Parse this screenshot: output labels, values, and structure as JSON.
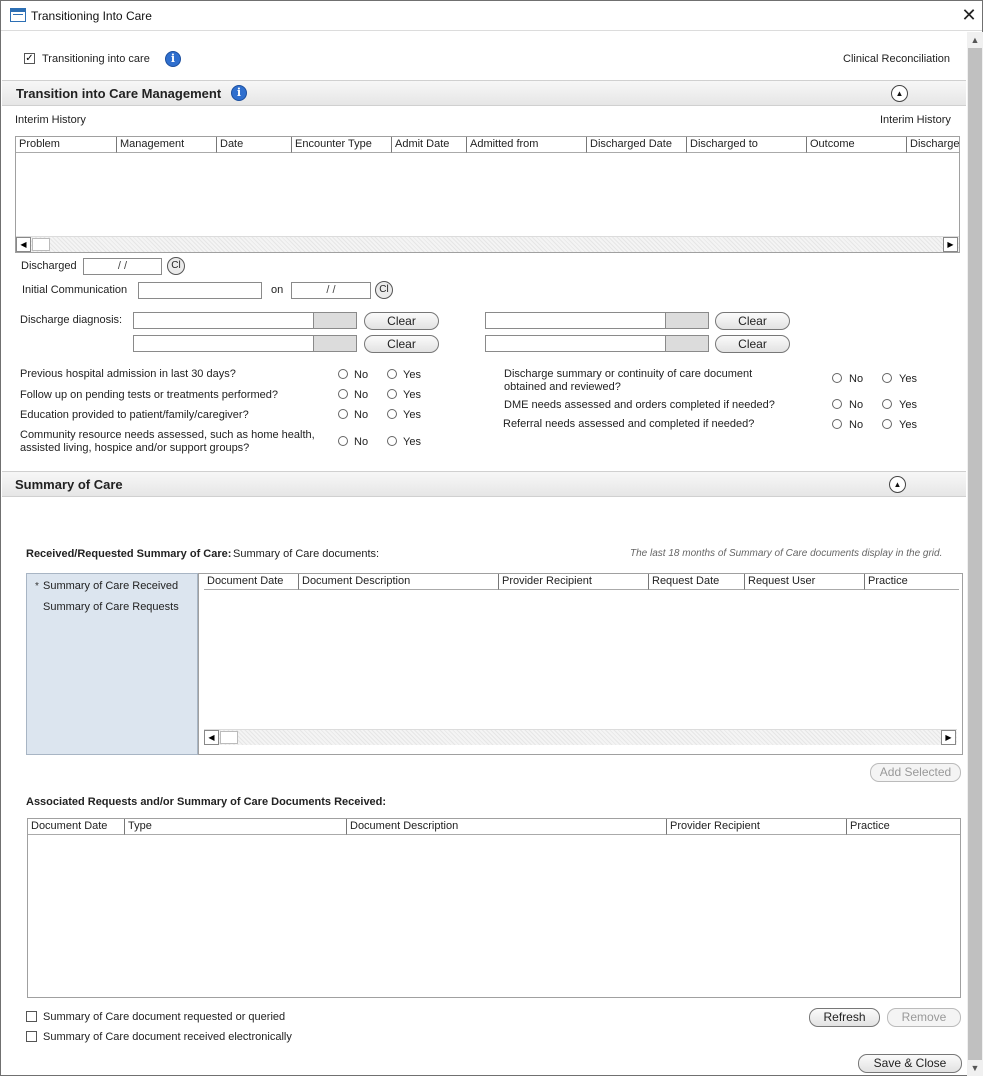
{
  "window": {
    "title": "Transitioning Into Care",
    "close_glyph": "✕"
  },
  "top": {
    "checkbox_label": "Transitioning into care",
    "checkbox_checked": true,
    "clinical_reconciliation_link": "Clinical Reconciliation"
  },
  "tic_section": {
    "title": "Transition into Care Management",
    "interim_history_label": "Interim History",
    "interim_history_link": "Interim History",
    "grid_columns": [
      "Problem",
      "Management",
      "Date",
      "Encounter Type",
      "Admit Date",
      "Admitted from",
      "Discharged Date",
      "Discharged to",
      "Outcome",
      "Discharge"
    ],
    "discharged_label": "Discharged",
    "discharged_value": "/ /",
    "initial_communication_label": "Initial Communication",
    "initial_communication_value": "",
    "on_label": "on",
    "on_value": "/ /",
    "cl_label": "Cl",
    "discharge_diagnosis_label": "Discharge diagnosis:",
    "clear_label": "Clear",
    "questions_left": [
      "Previous hospital admission in last 30 days?",
      "Follow up on pending tests or treatments performed?",
      "Education provided to patient/family/caregiver?",
      "Community resource needs assessed, such as home health, assisted living, hospice and/or support groups?"
    ],
    "questions_right": [
      "Discharge summary or continuity of care document obtained and reviewed?",
      "DME needs assessed and orders completed if needed?",
      "Referral needs assessed and completed if needed?"
    ],
    "no_label": "No",
    "yes_label": "Yes"
  },
  "soc_section": {
    "title": "Summary of Care",
    "received_label": "Received/Requested Summary of Care:",
    "documents_label": "Summary of Care documents:",
    "note": "The last 18 months of Summary of Care documents display in the grid.",
    "nav_items": [
      "Summary of Care Received",
      "Summary of Care Requests"
    ],
    "nav_bullet": "*",
    "grid_columns": [
      "Document Date",
      "Document Description",
      "Provider Recipient",
      "Request Date",
      "Request User",
      "Practice"
    ],
    "add_selected_label": "Add Selected",
    "associated_label": "Associated Requests and/or Summary of Care Documents Received:",
    "assoc_grid_columns": [
      "Document Date",
      "Type",
      "Document Description",
      "Provider Recipient",
      "Practice"
    ],
    "requested_checkbox_label": "Summary of Care document requested or queried",
    "received_checkbox_label": "Summary of Care document received electronically",
    "refresh_label": "Refresh",
    "remove_label": "Remove"
  },
  "footer": {
    "save_close_label": "Save & Close"
  },
  "colors": {
    "accent_link": "#3a78c8",
    "info_icon": "#2f6fce",
    "nav_pane": "#dce5ef"
  }
}
